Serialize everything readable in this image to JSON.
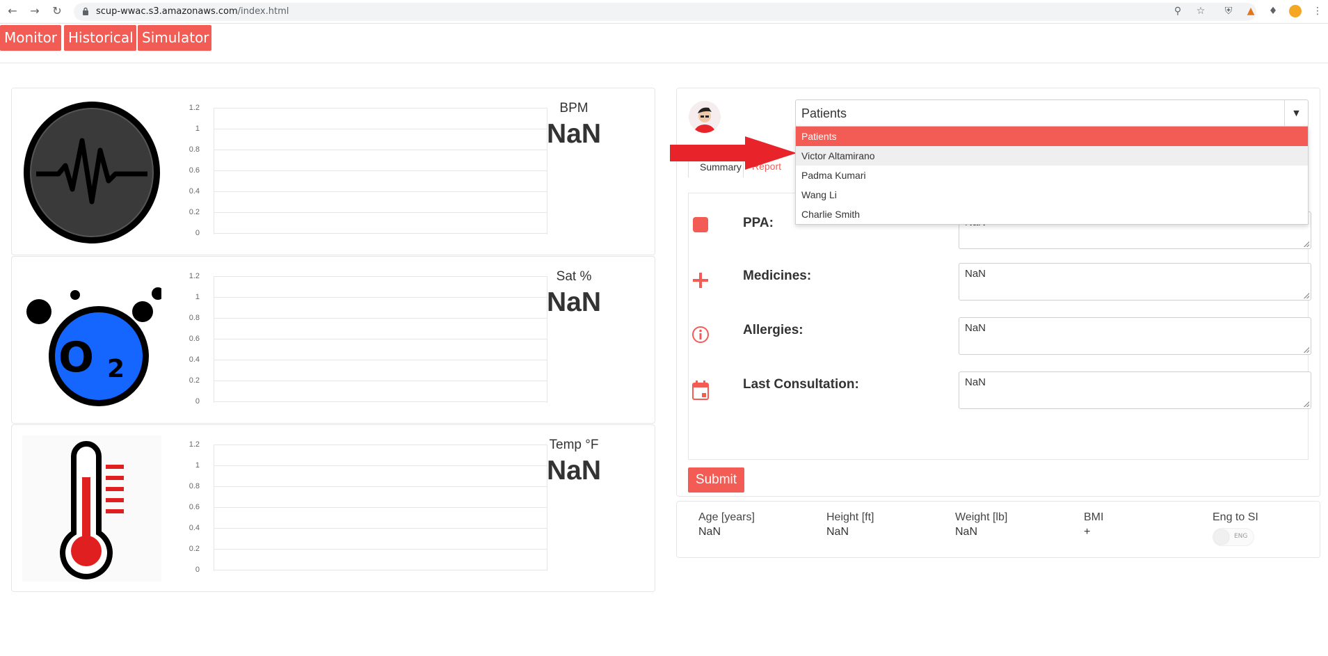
{
  "browser": {
    "url_host": "scup-wwac.s3.amazonaws.com",
    "url_path": "/index.html"
  },
  "topnav": [
    "Monitor",
    "Historical",
    "Simulator"
  ],
  "charts": {
    "ticks": [
      "1.2",
      "1",
      "0.8",
      "0.6",
      "0.4",
      "0.2",
      "0"
    ]
  },
  "metrics": [
    {
      "label": "BPM",
      "value": "NaN",
      "icon": "heartbeat-icon"
    },
    {
      "label": "Sat %",
      "value": "NaN",
      "icon": "oxygen-icon"
    },
    {
      "label": "Temp °F",
      "value": "NaN",
      "icon": "thermometer-icon"
    }
  ],
  "patient_select": {
    "value": "Patients",
    "options": [
      "Patients",
      "Victor Altamirano",
      "Padma Kumari",
      "Wang Li",
      "Charlie Smith"
    ],
    "selected_index": 0,
    "hovered_index": 1
  },
  "subtabs": [
    "Summary",
    "Report"
  ],
  "fields": [
    {
      "label": "PPA:",
      "value": "NaN",
      "icon": "square-icon"
    },
    {
      "label": "Medicines:",
      "value": "NaN",
      "icon": "plus-icon"
    },
    {
      "label": "Allergies:",
      "value": "NaN",
      "icon": "info-icon"
    },
    {
      "label": "Last Consultation:",
      "value": "NaN",
      "icon": "calendar-icon"
    }
  ],
  "submit_label": "Submit",
  "stats": [
    {
      "label": "Age [years]",
      "value": "NaN"
    },
    {
      "label": "Height [ft]",
      "value": "NaN"
    },
    {
      "label": "Weight [lb]",
      "value": "NaN"
    },
    {
      "label": "BMI",
      "value": "+"
    },
    {
      "label": "Eng to SI",
      "value": ""
    }
  ],
  "toggle_label": "ENG",
  "colors": {
    "accent": "#f25c54",
    "arrow": "#e8232a",
    "o2": "#1565ff"
  }
}
